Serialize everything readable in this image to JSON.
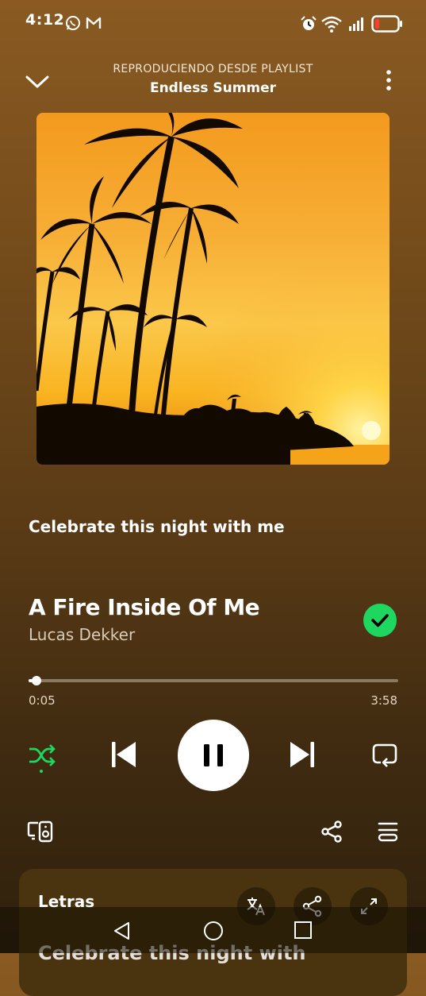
{
  "status_bar": {
    "time": "4:12",
    "icons": [
      "whatsapp-icon",
      "gmail-icon",
      "alarm-icon",
      "wifi-icon",
      "signal-icon",
      "battery-low-icon"
    ]
  },
  "header": {
    "context_label": "REPRODUCIENDO DESDE PLAYLIST",
    "playlist_name": "Endless Summer"
  },
  "lyric_line": "Celebrate this night with me",
  "track": {
    "title": "A Fire Inside Of Me",
    "artist": "Lucas Dekker",
    "elapsed": "0:05",
    "duration": "3:58",
    "progress_fraction": 0.021,
    "liked": true
  },
  "lyrics_card": {
    "label": "Letras",
    "preview": "Celebrate this night with"
  },
  "colors": {
    "accent_green": "#1ed760",
    "background_top": "#8a5a22",
    "background_bottom": "#2f200c"
  }
}
